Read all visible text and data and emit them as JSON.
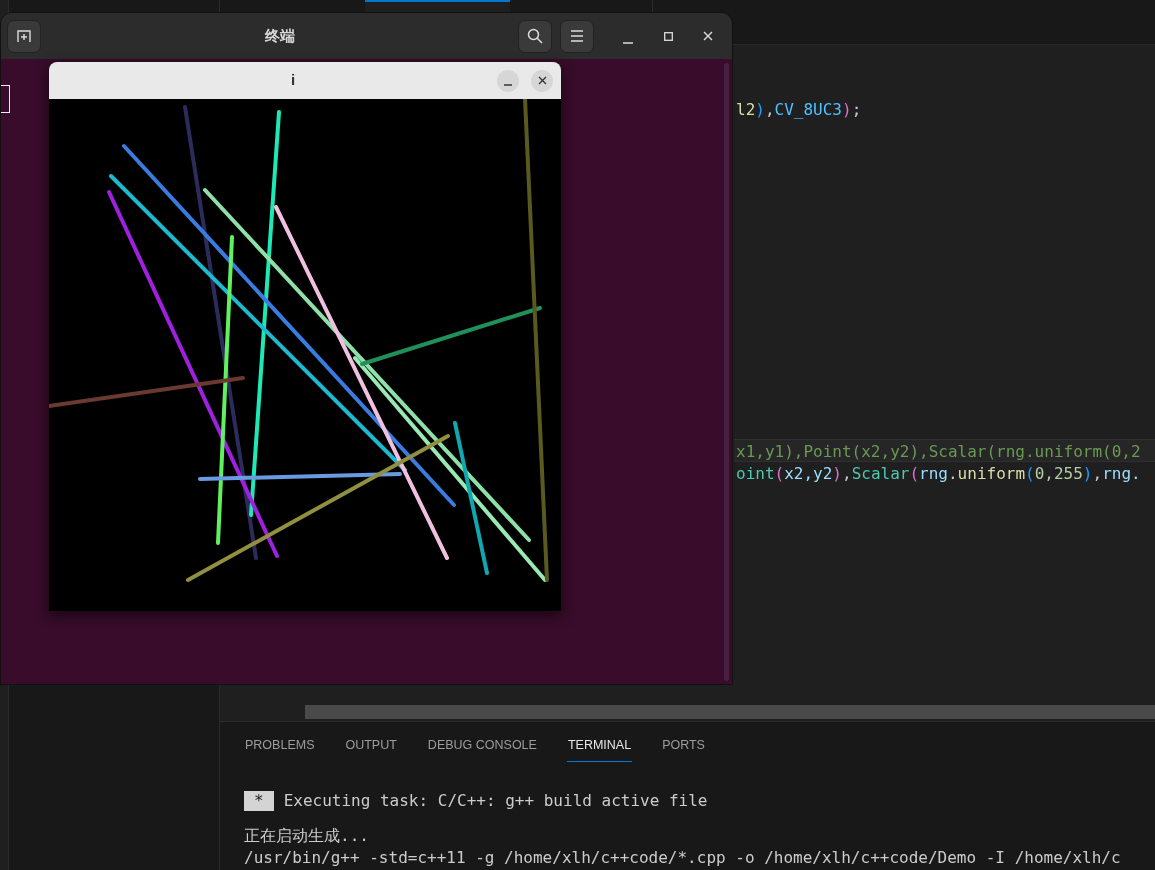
{
  "ide": {
    "code_lines": [
      {
        "current": false,
        "segments": [
          {
            "text": "l2",
            "kind": "func"
          },
          {
            "text": ")",
            "kind": "bracket1"
          },
          {
            "text": ",",
            "kind": "punct"
          },
          {
            "text": "CV_8UC3",
            "kind": "const"
          },
          {
            "text": ")",
            "kind": "bracket2"
          },
          {
            "text": ";",
            "kind": "punct"
          }
        ]
      },
      {
        "current": true,
        "segments": [
          {
            "text": "x1,y1),Point(x2,y2),Scalar(rng.uniform(0,2",
            "kind": "ghost"
          }
        ]
      },
      {
        "current": false,
        "segments": [
          {
            "text": "oint",
            "kind": "class"
          },
          {
            "text": "(",
            "kind": "bracket2"
          },
          {
            "text": "x2,y2",
            "kind": "var"
          },
          {
            "text": ")",
            "kind": "bracket2"
          },
          {
            "text": ",",
            "kind": "punct"
          },
          {
            "text": "Scalar",
            "kind": "class"
          },
          {
            "text": "(",
            "kind": "bracket2"
          },
          {
            "text": "rng",
            "kind": "var"
          },
          {
            "text": ".",
            "kind": "punct"
          },
          {
            "text": "uniform",
            "kind": "func"
          },
          {
            "text": "(",
            "kind": "bracket1"
          },
          {
            "text": "0,255",
            "kind": "num"
          },
          {
            "text": ")",
            "kind": "bracket1"
          },
          {
            "text": ",",
            "kind": "punct"
          },
          {
            "text": "rng.",
            "kind": "var"
          }
        ]
      }
    ],
    "panel_tabs": [
      {
        "label": "PROBLEMS",
        "selected": false
      },
      {
        "label": "OUTPUT",
        "selected": false
      },
      {
        "label": "DEBUG CONSOLE",
        "selected": false
      },
      {
        "label": "TERMINAL",
        "selected": true
      },
      {
        "label": "PORTS",
        "selected": false
      }
    ],
    "terminal": {
      "task_marker": "*",
      "task": "Executing task: C/C++: g++ build active file",
      "lines": [
        "正在启动生成...",
        "/usr/bin/g++ -std=c++11 -g /home/xlh/c++code/*.cpp -o /home/xlh/c++code/Demo -I /home/xlh/c"
      ]
    }
  },
  "terminal_window": {
    "title": "终端"
  },
  "image_window": {
    "title": "i"
  }
}
